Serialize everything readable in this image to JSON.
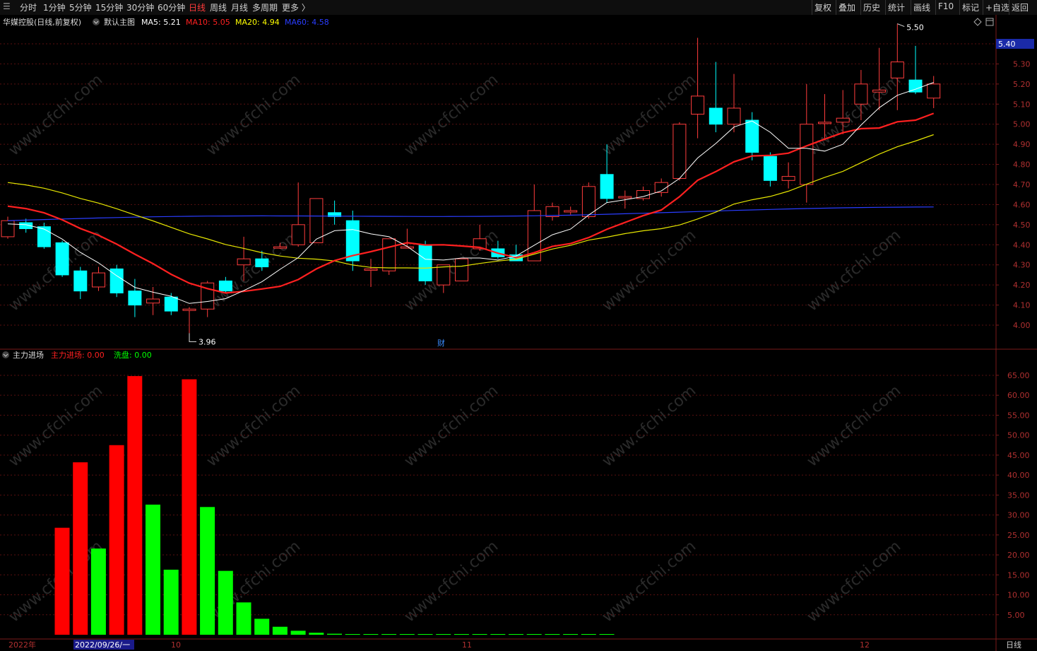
{
  "toolbar": {
    "left_items": [
      "分时",
      "1分钟",
      "5分钟",
      "15分钟",
      "30分钟",
      "60分钟",
      "日线",
      "周线",
      "月线",
      "多周期",
      "更多 〉"
    ],
    "active": "日线",
    "right_items": [
      "复权",
      "叠加",
      "历史",
      "统计",
      "画线",
      "F10",
      "标记",
      "+自选",
      "返回"
    ]
  },
  "header": {
    "stock": "华媒控股(日线,前复权)",
    "template": "默认主图",
    "ma": [
      {
        "label": "MA5: 5.21",
        "color": "#ffffff"
      },
      {
        "label": "MA10: 5.05",
        "color": "#ff2020"
      },
      {
        "label": "MA20: 4.94",
        "color": "#ffff00"
      },
      {
        "label": "MA60: 4.58",
        "color": "#2a3dff"
      }
    ]
  },
  "indicator": {
    "name": "主力进场",
    "v1": "主力进场: 0.00",
    "v2": "洗盘: 0.00"
  },
  "annotations": {
    "high": "5.50",
    "low": "3.96",
    "current_price": "5.40",
    "cai": "财"
  },
  "price_axis": [
    "5.40",
    "5.30",
    "5.20",
    "5.10",
    "5.00",
    "4.90",
    "4.80",
    "4.70",
    "4.60",
    "4.50",
    "4.40",
    "4.30",
    "4.20",
    "4.10",
    "4.00"
  ],
  "indicator_axis": [
    "65.00",
    "60.00",
    "55.00",
    "50.00",
    "45.00",
    "40.00",
    "35.00",
    "30.00",
    "25.00",
    "20.00",
    "15.00",
    "10.00",
    "5.00"
  ],
  "date_axis": {
    "year": "2022年",
    "cursor": "2022/09/26/一",
    "oct": "10",
    "nov": "11",
    "dec": "12",
    "period": "日线"
  },
  "watermark": "www.cfchi.com",
  "colors": {
    "up": "#ff3c3c",
    "down": "#00ffff",
    "bg": "#000000",
    "grid": "#5a1010",
    "ma5": "#ffffff",
    "ma10": "#ff2020",
    "ma20": "#e6e600",
    "ma60": "#2a3dff",
    "bar_red": "#ff0000",
    "bar_green": "#00ff00"
  },
  "chart_data": {
    "type": "candlestick",
    "candles": [
      [
        4.44,
        4.52,
        4.54,
        4.43
      ],
      [
        4.51,
        4.48,
        4.53,
        4.46
      ],
      [
        4.49,
        4.39,
        4.51,
        4.38
      ],
      [
        4.41,
        4.25,
        4.42,
        4.24
      ],
      [
        4.27,
        4.17,
        4.29,
        4.13
      ],
      [
        4.19,
        4.26,
        4.29,
        4.17
      ],
      [
        4.28,
        4.16,
        4.3,
        4.14
      ],
      [
        4.17,
        4.1,
        4.23,
        4.04
      ],
      [
        4.11,
        4.13,
        4.19,
        4.05
      ],
      [
        4.14,
        4.07,
        4.16,
        4.05
      ],
      [
        4.08,
        4.08,
        4.09,
        3.96
      ],
      [
        4.08,
        4.21,
        4.22,
        4.04
      ],
      [
        4.22,
        4.17,
        4.24,
        4.16
      ],
      [
        4.3,
        4.33,
        4.44,
        4.22
      ],
      [
        4.33,
        4.29,
        4.37,
        4.27
      ],
      [
        4.39,
        4.39,
        4.41,
        4.38
      ],
      [
        4.4,
        4.5,
        4.71,
        4.39
      ],
      [
        4.41,
        4.63,
        4.62,
        4.41
      ],
      [
        4.56,
        4.54,
        4.62,
        4.5
      ],
      [
        4.52,
        4.32,
        4.57,
        4.27
      ],
      [
        4.28,
        4.28,
        4.33,
        4.19
      ],
      [
        4.27,
        4.43,
        4.43,
        4.25
      ],
      [
        4.39,
        4.39,
        4.48,
        4.39
      ],
      [
        4.4,
        4.22,
        4.42,
        4.2
      ],
      [
        4.2,
        4.3,
        4.3,
        4.16
      ],
      [
        4.22,
        4.33,
        4.33,
        4.22
      ],
      [
        4.38,
        4.43,
        4.5,
        4.37
      ],
      [
        4.38,
        4.34,
        4.42,
        4.33
      ],
      [
        4.35,
        4.32,
        4.4,
        4.32
      ],
      [
        4.32,
        4.57,
        4.7,
        4.32
      ],
      [
        4.54,
        4.59,
        4.61,
        4.52
      ],
      [
        4.57,
        4.57,
        4.59,
        4.55
      ],
      [
        4.54,
        4.69,
        4.71,
        4.53
      ],
      [
        4.75,
        4.63,
        4.9,
        4.61
      ],
      [
        4.64,
        4.64,
        4.67,
        4.58
      ],
      [
        4.63,
        4.67,
        4.69,
        4.62
      ],
      [
        4.66,
        4.71,
        4.73,
        4.64
      ],
      [
        4.73,
        5.0,
        5.01,
        4.72
      ],
      [
        5.05,
        5.14,
        5.43,
        4.93
      ],
      [
        5.08,
        5.0,
        5.31,
        4.96
      ],
      [
        5.0,
        5.08,
        5.25,
        4.96
      ],
      [
        5.02,
        4.86,
        5.06,
        4.82
      ],
      [
        4.84,
        4.72,
        4.86,
        4.69
      ],
      [
        4.72,
        4.74,
        4.81,
        4.68
      ],
      [
        4.7,
        5.0,
        5.2,
        4.61
      ],
      [
        5.01,
        5.01,
        5.15,
        4.92
      ],
      [
        5.01,
        5.03,
        5.17,
        4.95
      ],
      [
        5.1,
        5.2,
        5.27,
        5.02
      ],
      [
        5.16,
        5.17,
        5.38,
        5.07
      ],
      [
        5.23,
        5.31,
        5.5,
        5.07
      ],
      [
        5.22,
        5.16,
        5.39,
        5.15
      ],
      [
        5.13,
        5.2,
        5.24,
        5.08
      ]
    ],
    "ma5_end": 5.21,
    "ma10_end": 5.05,
    "ma20_end": 4.94,
    "ma60_end": 4.58,
    "indicator_bars": [
      {
        "v": 26.8,
        "c": "r"
      },
      {
        "v": 43.2,
        "c": "r"
      },
      {
        "v": 21.6,
        "c": "g"
      },
      {
        "v": 47.5,
        "c": "r"
      },
      {
        "v": 64.8,
        "c": "r"
      },
      {
        "v": 32.6,
        "c": "g"
      },
      {
        "v": 16.3,
        "c": "g"
      },
      {
        "v": 64.0,
        "c": "r"
      },
      {
        "v": 32.0,
        "c": "g"
      },
      {
        "v": 16.0,
        "c": "g"
      },
      {
        "v": 8.1,
        "c": "g"
      },
      {
        "v": 4.0,
        "c": "g"
      },
      {
        "v": 2.0,
        "c": "g"
      },
      {
        "v": 1.0,
        "c": "g"
      },
      {
        "v": 0.5,
        "c": "g"
      },
      {
        "v": 0.25,
        "c": "g"
      },
      {
        "v": 0.12,
        "c": "g"
      },
      {
        "v": 0.06,
        "c": "g"
      },
      {
        "v": 0.03,
        "c": "g"
      },
      {
        "v": 0.02,
        "c": "g"
      },
      {
        "v": 0.01,
        "c": "g"
      },
      {
        "v": 0.01,
        "c": "g"
      },
      {
        "v": 0.0,
        "c": "g"
      },
      {
        "v": 0.0,
        "c": "g"
      },
      {
        "v": 0.0,
        "c": "g"
      },
      {
        "v": 0.0,
        "c": "g"
      },
      {
        "v": 0.0,
        "c": "g"
      },
      {
        "v": 0.0,
        "c": "g"
      },
      {
        "v": 0.0,
        "c": "g"
      },
      {
        "v": 0.0,
        "c": "g"
      },
      {
        "v": 0.0,
        "c": "g"
      }
    ],
    "price_range": [
      3.88,
      5.48
    ],
    "indicator_range": [
      0,
      68
    ]
  }
}
